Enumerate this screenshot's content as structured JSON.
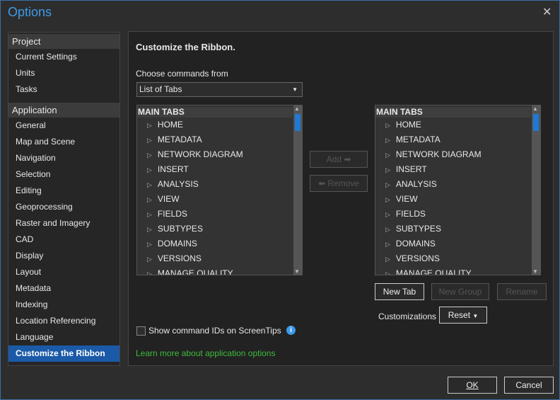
{
  "window": {
    "title": "Options",
    "close_icon": "close-icon"
  },
  "sidebar": {
    "groups": [
      {
        "label": "Project",
        "items": [
          "Current Settings",
          "Units",
          "Tasks"
        ]
      },
      {
        "label": "Application",
        "items": [
          "General",
          "Map and Scene",
          "Navigation",
          "Selection",
          "Editing",
          "Geoprocessing",
          "Raster and Imagery",
          "CAD",
          "Display",
          "Layout",
          "Metadata",
          "Indexing",
          "Location Referencing",
          "Language",
          "Customize the Ribbon"
        ]
      }
    ],
    "selected": "Customize the Ribbon"
  },
  "main": {
    "heading": "Customize the Ribbon.",
    "choose_label": "Choose commands from",
    "choose_value": "List of Tabs",
    "left_list": {
      "header": "MAIN TABS",
      "items": [
        "HOME",
        "METADATA",
        "NETWORK DIAGRAM",
        "INSERT",
        "ANALYSIS",
        "VIEW",
        "FIELDS",
        "SUBTYPES",
        "DOMAINS",
        "VERSIONS",
        "MANAGE QUALITY"
      ]
    },
    "right_list": {
      "header": "MAIN TABS",
      "items": [
        "HOME",
        "METADATA",
        "NETWORK DIAGRAM",
        "INSERT",
        "ANALYSIS",
        "VIEW",
        "FIELDS",
        "SUBTYPES",
        "DOMAINS",
        "VERSIONS",
        "MANAGE QUALITY"
      ]
    },
    "add_label": "Add",
    "remove_label": "Remove",
    "new_tab": "New Tab",
    "new_group": "New Group",
    "rename": "Rename",
    "customizations_label": "Customizations",
    "reset_label": "Reset",
    "show_ids_label": "Show command IDs on ScreenTips",
    "show_ids_checked": false,
    "learn_more": "Learn more about application options"
  },
  "footer": {
    "ok": "OK",
    "cancel": "Cancel"
  },
  "colors": {
    "accent": "#1e7ad4",
    "title": "#3d9be9",
    "link": "#3dbb3d"
  }
}
